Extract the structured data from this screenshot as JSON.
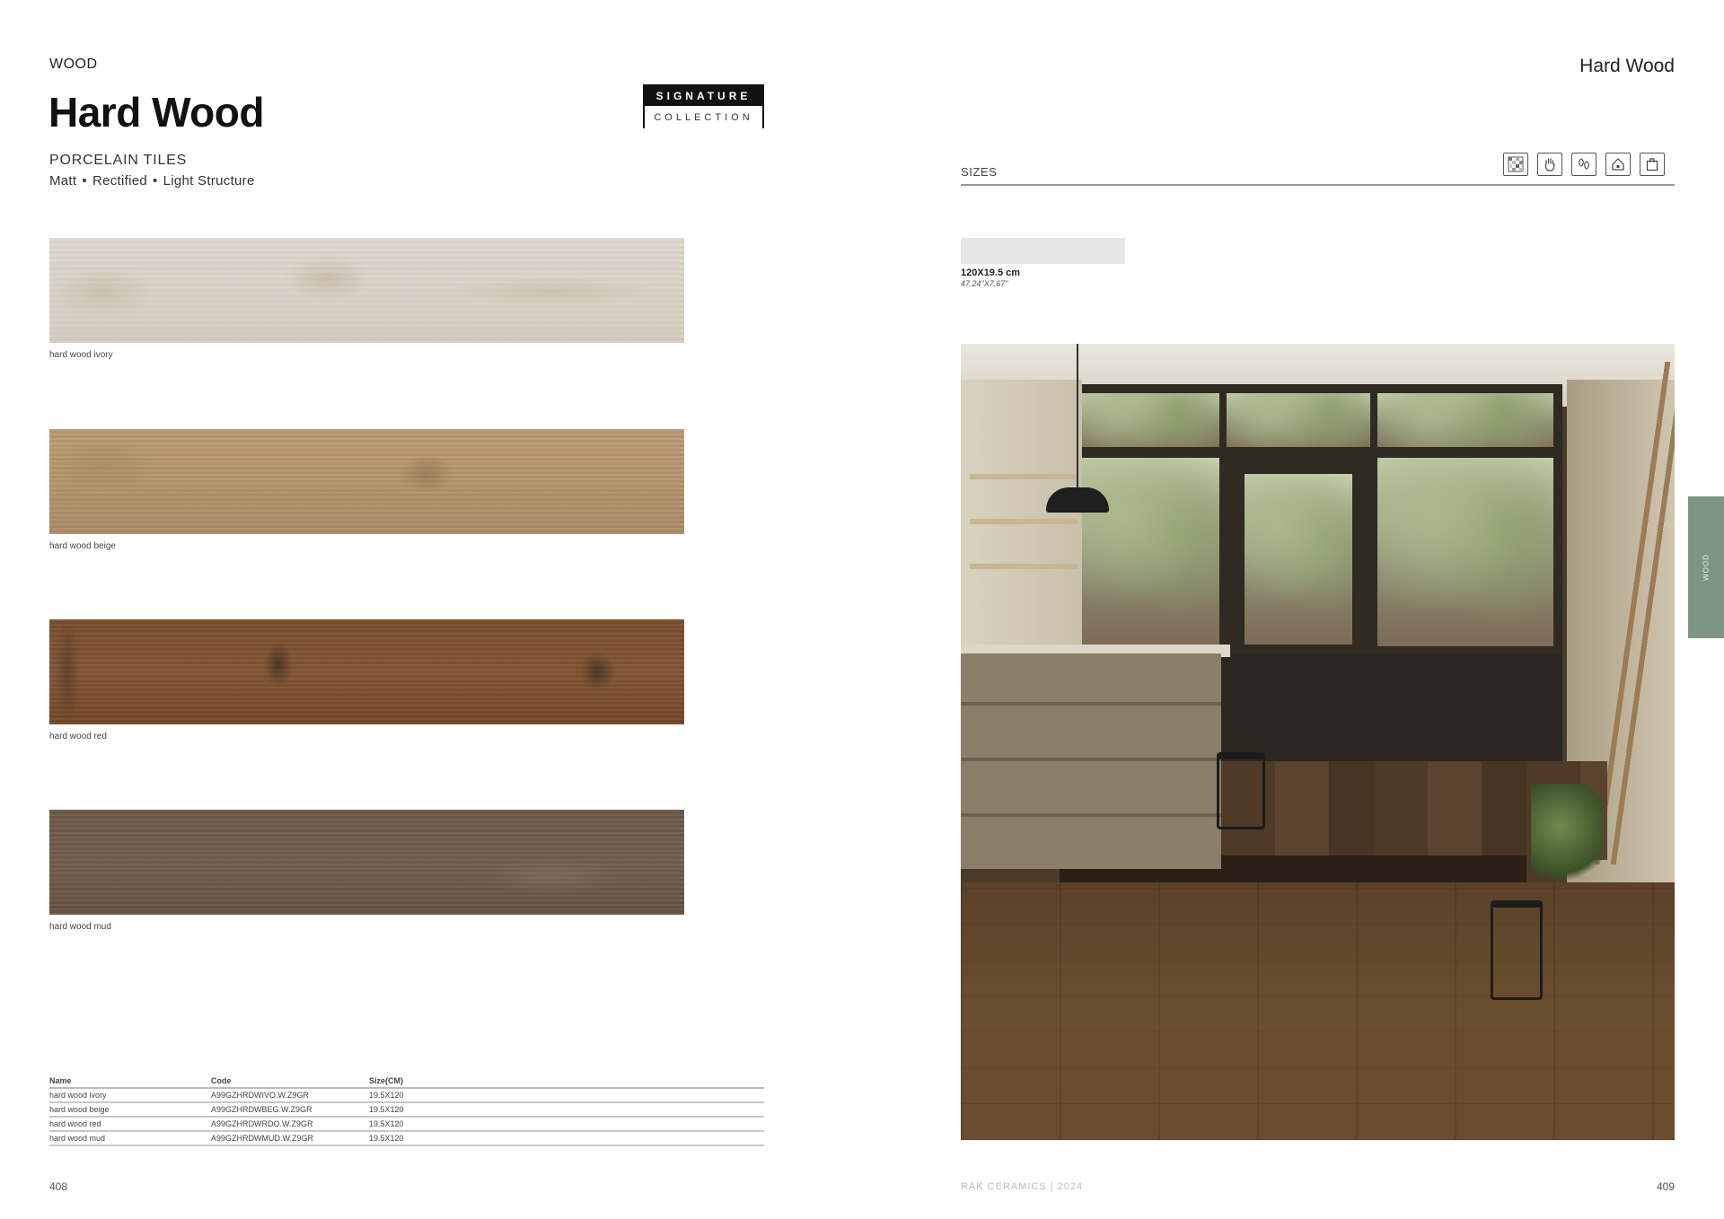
{
  "left_page": {
    "category": "WOOD",
    "title": "Hard Wood",
    "subtitle": "PORCELAIN TILES",
    "features": [
      "Matt",
      "Rectified",
      "Light Structure"
    ],
    "feature_separator": "•",
    "badge": {
      "top": "SIGNATURE",
      "bottom": "COLLECTION"
    },
    "tiles": [
      {
        "label": "hard wood ivory",
        "color": "#d8d1c5"
      },
      {
        "label": "hard wood beige",
        "color": "#b3946d"
      },
      {
        "label": "hard wood red",
        "color": "#7e5435"
      },
      {
        "label": "hard wood mud",
        "color": "#6f5c4c"
      }
    ],
    "table": {
      "headers": [
        "Name",
        "Code",
        "Size(CM)"
      ],
      "rows": [
        [
          "hard wood ivory",
          "A99GZHRDWIVO.W.Z9GR",
          "19.5X120"
        ],
        [
          "hard wood beige",
          "A99GZHRDWBEG.W.Z9GR",
          "19.5X120"
        ],
        [
          "hard wood red",
          "A99GZHRDWRDO.W.Z9GR",
          "19.5X120"
        ],
        [
          "hard wood mud",
          "A99GZHRDWMUD.W.Z9GR",
          "19.5X120"
        ]
      ]
    },
    "page_number": "408"
  },
  "right_page": {
    "title": "Hard Wood",
    "sizes_label": "SIZES",
    "icons": [
      "mosaic-pattern-icon",
      "hand-touch-icon",
      "footprints-icon",
      "house-icon",
      "shopping-bag-icon"
    ],
    "size": {
      "metric": "120X19.5 cm",
      "imperial": "47.24\"X7.67\""
    },
    "photo_alt": "Shop interior with hard wood red floor tiles",
    "side_tab": "WOOD",
    "side_tab_color": "#7d9683",
    "footer_brand": "RAK CERAMICS | 2024",
    "page_number": "409"
  }
}
